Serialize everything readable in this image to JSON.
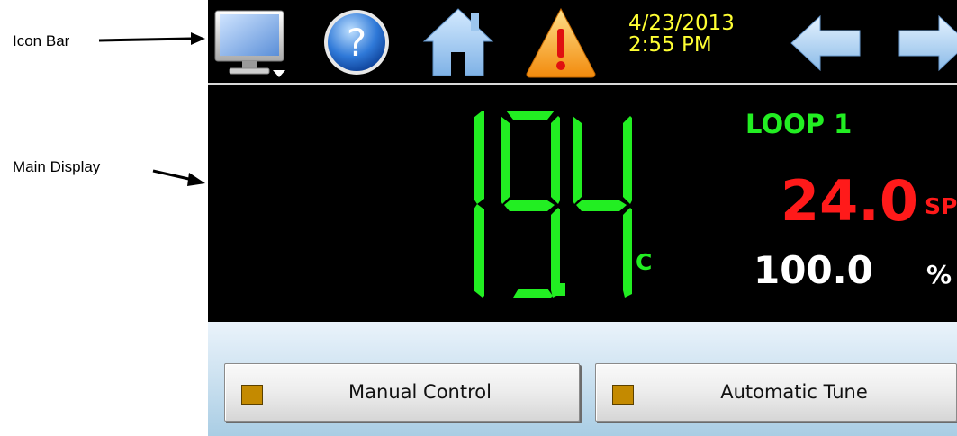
{
  "annotations": {
    "icon_bar_label": "Icon Bar",
    "main_display_label": "Main Display"
  },
  "icon_bar": {
    "icons": [
      "monitor-icon",
      "help-icon",
      "home-icon",
      "alarm-warning-icon",
      "arrow-left-icon",
      "arrow-right-icon"
    ],
    "date": "4/23/2013",
    "time": "2:55 PM",
    "datetime_color": "#ffff33"
  },
  "main_display": {
    "process_value": "19.4",
    "process_unit": "C",
    "loop_label": "LOOP 1",
    "setpoint_value": "24.0",
    "setpoint_unit": "SP",
    "output_value": "100.0",
    "output_unit": "%",
    "colors": {
      "process": "#22ee22",
      "setpoint": "#ff1a1a",
      "output": "#ffffff"
    }
  },
  "controls": {
    "manual_control_label": "Manual Control",
    "automatic_tune_label": "Automatic Tune",
    "indicator_color": "#c48a00"
  }
}
